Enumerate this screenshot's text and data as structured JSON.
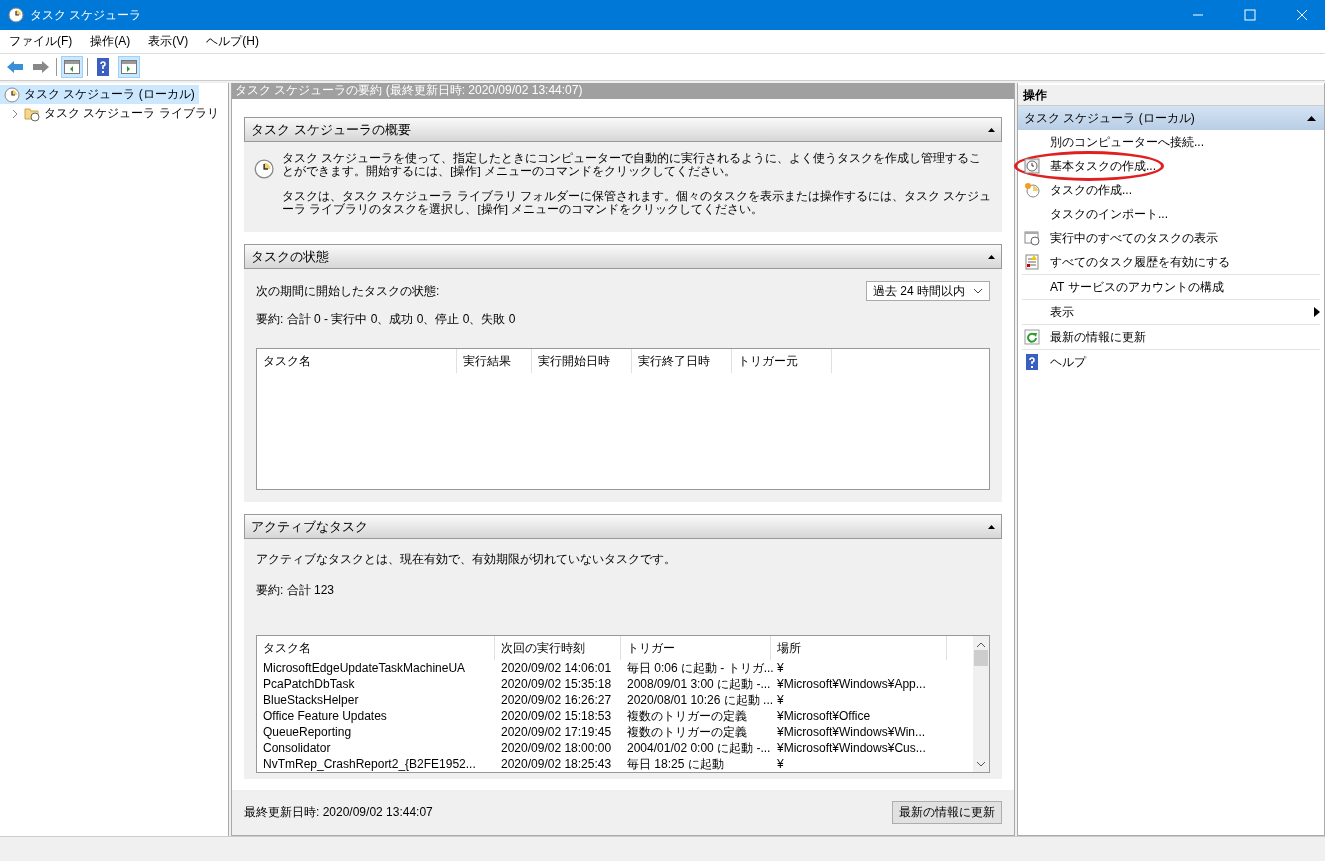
{
  "window": {
    "title": "タスク スケジューラ"
  },
  "menu": [
    "ファイル(F)",
    "操作(A)",
    "表示(V)",
    "ヘルプ(H)"
  ],
  "tree": [
    {
      "label": "タスク スケジューラ (ローカル)",
      "selected": true,
      "children": [
        {
          "label": "タスク スケジューラ ライブラリ",
          "selected": false,
          "expanded": false
        }
      ]
    }
  ],
  "summary_header": "タスク スケジューラの要約 (最終更新日時: 2020/09/02 13:44:07)",
  "overview": {
    "title": "タスク スケジューラの概要",
    "paragraphs": [
      "タスク スケジューラを使って、指定したときにコンピューターで自動的に実行されるように、よく使うタスクを作成し管理することができます。開始するには、[操作] メニューのコマンドをクリックしてください。",
      "タスクは、タスク スケジューラ ライブラリ フォルダーに保管されます。個々のタスクを表示または操作するには、タスク スケジューラ ライブラリのタスクを選択し、[操作] メニューのコマンドをクリックしてください。"
    ]
  },
  "task_status": {
    "title": "タスクの状態",
    "period_label": "次の期間に開始したタスクの状態:",
    "period_value": "過去 24 時間以内",
    "summary": "要約: 合計 0 - 実行中 0、成功 0、停止 0、失敗 0",
    "columns": [
      "タスク名",
      "実行結果",
      "実行開始日時",
      "実行終了日時",
      "トリガー元"
    ]
  },
  "active_tasks": {
    "title": "アクティブなタスク",
    "description": "アクティブなタスクとは、現在有効で、有効期限が切れていないタスクです。",
    "summary": "要約: 合計 123",
    "columns": [
      "タスク名",
      "次回の実行時刻",
      "トリガー",
      "場所"
    ],
    "rows": [
      [
        "MicrosoftEdgeUpdateTaskMachineUA",
        "2020/09/02 14:06:01",
        "毎日 0:06 に起動 - トリガ...",
        "¥"
      ],
      [
        "PcaPatchDbTask",
        "2020/09/02 15:35:18",
        "2008/09/01 3:00 に起動 -...",
        "¥Microsoft¥Windows¥App..."
      ],
      [
        "BlueStacksHelper",
        "2020/09/02 16:26:27",
        "2020/08/01 10:26 に起動 ...",
        "¥"
      ],
      [
        "Office Feature Updates",
        "2020/09/02 15:18:53",
        "複数のトリガーの定義",
        "¥Microsoft¥Office"
      ],
      [
        "QueueReporting",
        "2020/09/02 17:19:45",
        "複数のトリガーの定義",
        "¥Microsoft¥Windows¥Win..."
      ],
      [
        "Consolidator",
        "2020/09/02 18:00:00",
        "2004/01/02 0:00 に起動 -...",
        "¥Microsoft¥Windows¥Cus..."
      ],
      [
        "NvTmRep_CrashReport2_{B2FE1952...",
        "2020/09/02 18:25:43",
        "毎日 18:25 に起動",
        "¥"
      ]
    ]
  },
  "footer": {
    "last_updated": "最終更新日時: 2020/09/02 13:44:07",
    "refresh_button": "最新の情報に更新"
  },
  "actions": {
    "title": "操作",
    "section": "タスク スケジューラ (ローカル)",
    "groups": [
      [
        {
          "label": "別のコンピューターへ接続...",
          "kind": "plain",
          "circled": false
        },
        {
          "label": "基本タスクの作成...",
          "kind": "basic",
          "circled": true
        },
        {
          "label": "タスクの作成...",
          "kind": "task",
          "circled": false
        },
        {
          "label": "タスクのインポート...",
          "kind": "plain",
          "circled": false
        },
        {
          "label": "実行中のすべてのタスクの表示",
          "kind": "running",
          "circled": false
        },
        {
          "label": "すべてのタスク履歴を有効にする",
          "kind": "history",
          "circled": false
        }
      ],
      [
        {
          "label": "AT サービスのアカウントの構成",
          "kind": "plain",
          "circled": false
        }
      ],
      [
        {
          "label": "表示",
          "kind": "plain",
          "circled": false,
          "submenu": true
        }
      ],
      [
        {
          "label": "最新の情報に更新",
          "kind": "refresh",
          "circled": false
        }
      ],
      [
        {
          "label": "ヘルプ",
          "kind": "help",
          "circled": false
        }
      ]
    ]
  }
}
